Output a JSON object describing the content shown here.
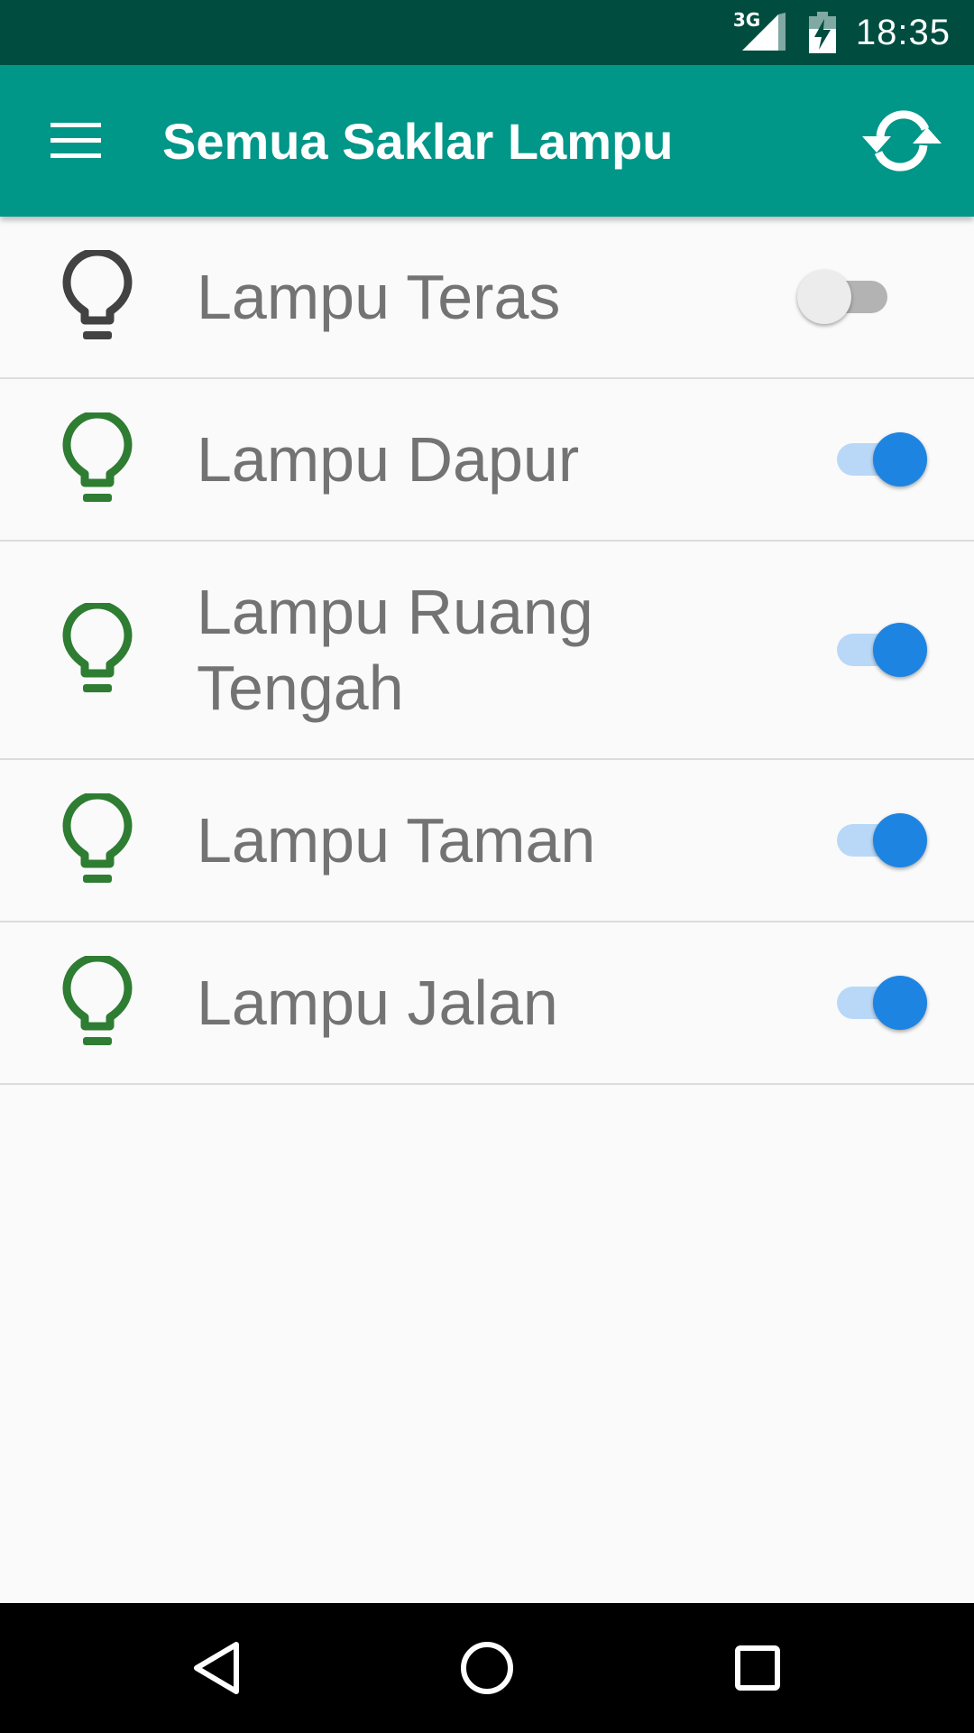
{
  "status_bar": {
    "network": "3G",
    "time": "18:35"
  },
  "app_bar": {
    "menu_icon": "hamburger-menu-icon",
    "title": "Semua Saklar Lampu",
    "refresh_icon": "refresh-icon"
  },
  "colors": {
    "status_bar": "#004d40",
    "app_bar": "#009688",
    "bulb_on": "#2e7d32",
    "bulb_off": "#424242",
    "switch_on_thumb": "#1e84e2",
    "switch_on_track": "#b9d8f7",
    "switch_off_thumb": "#ececec",
    "switch_off_track": "#b3b3b3",
    "label_text": "#737373"
  },
  "lamps": [
    {
      "label": "Lampu Teras",
      "on": false,
      "icon": "lightbulb-off-icon"
    },
    {
      "label": "Lampu Dapur",
      "on": true,
      "icon": "lightbulb-on-icon"
    },
    {
      "label": "Lampu Ruang Tengah",
      "on": true,
      "icon": "lightbulb-on-icon"
    },
    {
      "label": "Lampu Taman",
      "on": true,
      "icon": "lightbulb-on-icon"
    },
    {
      "label": "Lampu Jalan",
      "on": true,
      "icon": "lightbulb-on-icon"
    }
  ],
  "nav_bar": {
    "back_icon": "back-triangle-icon",
    "home_icon": "home-circle-icon",
    "recents_icon": "recents-square-icon"
  }
}
